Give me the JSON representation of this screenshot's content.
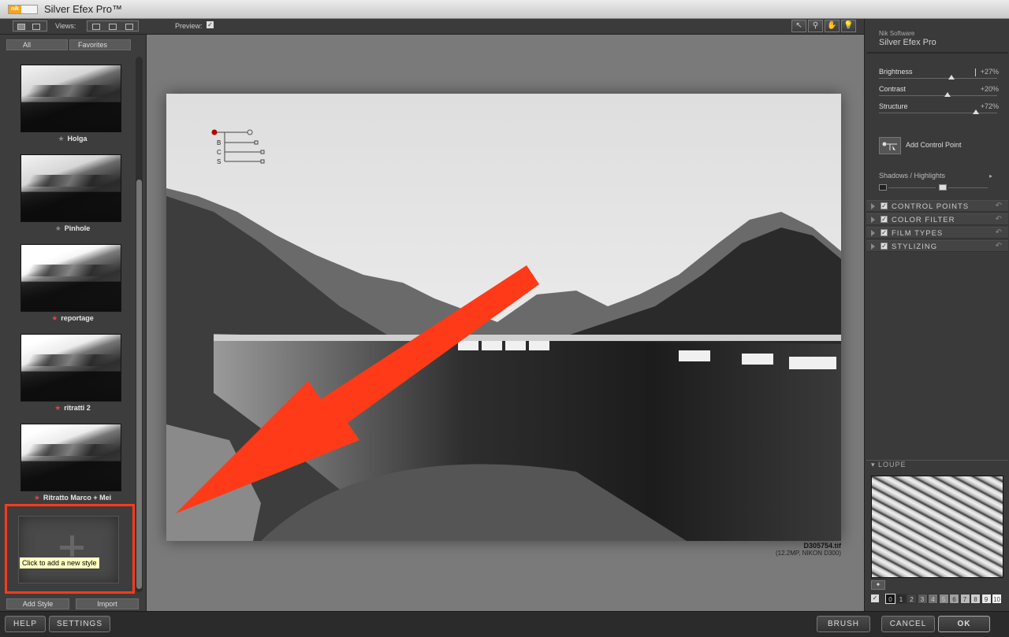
{
  "window": {
    "title": "Silver Efex Pro™",
    "nik_badge": "nik"
  },
  "toolbar": {
    "views_label": "Views:",
    "preview_label": "Preview:",
    "preview_checked": "✓",
    "tools": [
      "↖",
      "⚲",
      "✋",
      "💡"
    ],
    "tool_names": [
      "select",
      "zoom",
      "pan",
      "light"
    ]
  },
  "left_panel": {
    "tabs": [
      "All",
      "Favorites"
    ],
    "styles": [
      {
        "name": "Holga",
        "favorite": false
      },
      {
        "name": "Pinhole",
        "favorite": false
      },
      {
        "name": "reportage",
        "favorite": true
      },
      {
        "name": "ritratti 2",
        "favorite": true
      },
      {
        "name": "Ritratto Marco + Mei",
        "favorite": true
      }
    ],
    "add_new_tooltip": "Click to add a new style",
    "add_style_label": "Add Style",
    "import_label": "Import",
    "scroll_fraction": 0.23
  },
  "image": {
    "filename": "D305754.tif",
    "info": "(12.2MP, NIKON D300)",
    "control_point_labels": [
      "B",
      "C",
      "S"
    ]
  },
  "right_panel": {
    "brand": "Nik Software",
    "product": "Silver Efex Pro",
    "sliders": [
      {
        "label": "Brightness",
        "value": "+27%",
        "level": 0.61
      },
      {
        "label": "Contrast",
        "value": "+20%",
        "level": 0.58
      },
      {
        "label": "Structure",
        "value": "+72%",
        "level": 0.82
      }
    ],
    "add_control_point_label": "Add Control Point",
    "shadows_highlights_label": "Shadows / Highlights",
    "sections": [
      "CONTROL POINTS",
      "COLOR FILTER",
      "FILM TYPES",
      "STYLIZING"
    ],
    "loupe_label": "LOUPE",
    "zones": [
      "0",
      "1",
      "2",
      "3",
      "4",
      "5",
      "6",
      "7",
      "8",
      "9",
      "10"
    ]
  },
  "bottom": {
    "help": "HELP",
    "settings": "SETTINGS",
    "brush": "BRUSH",
    "cancel": "CANCEL",
    "ok": "OK"
  },
  "colors": {
    "annotation": "#ff3a18",
    "favorite_star": "#e4404a"
  }
}
